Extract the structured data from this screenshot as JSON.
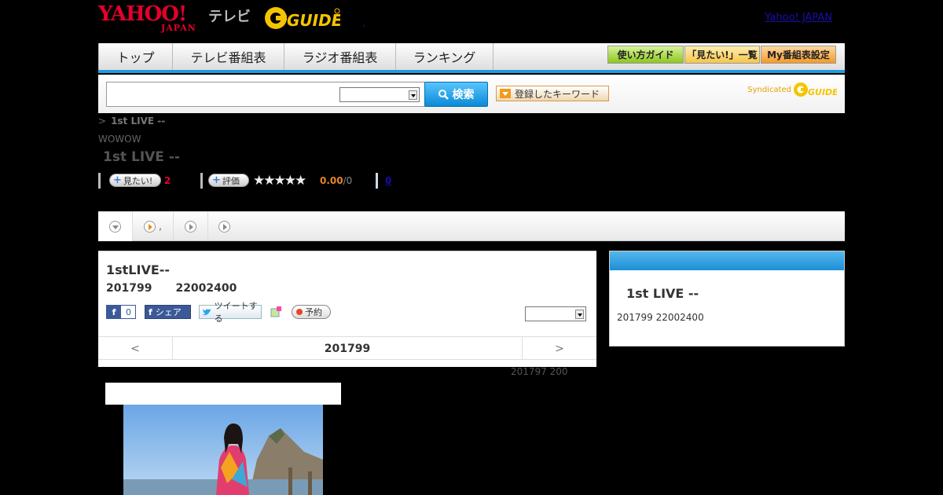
{
  "header": {
    "yahoo_logo": "YAHOO!",
    "yahoo_sub": "JAPAN",
    "tv_label": "テレビ",
    "gguide_logo": "G GUIDE",
    "dot": ",",
    "link": "Yahoo! JAPAN"
  },
  "nav": {
    "tabs": [
      "トップ",
      "テレビ番組表",
      "ラジオ番組表",
      "ランキング"
    ],
    "buttons": [
      "使い方ガイド",
      "「見たい!」一覧",
      "My番組表設定"
    ]
  },
  "search": {
    "button": "検索",
    "keyword_button": "登録したキーワード",
    "syndicated": "Syndicated",
    "brand": "G GUIDE"
  },
  "breadcrumb": {
    "sep": ">",
    "current": "1st LIVE --"
  },
  "program": {
    "channel": "WOWOW",
    "title": "1st LIVE --",
    "want_label": "見たい!",
    "want_count": "2",
    "rate_label": "評価",
    "stars": "★★★★★",
    "score": "0.00",
    "score_total": "/0",
    "comments": "0"
  },
  "tabbar": {
    "second_label": ","
  },
  "main": {
    "title": "1stLIVE--",
    "date": "201799",
    "time": "22002400",
    "fb_count": "0",
    "share": "シェア",
    "tweet": "ツイートする",
    "reserve": "予約",
    "pager_prev": "<",
    "pager_date": "201799",
    "pager_next": ">",
    "foot_note": "201797  200"
  },
  "side": {
    "title": "1st LIVE --",
    "date": "201799  22002400"
  },
  "colors": {
    "accent_blue": "#1e9be0",
    "yahoo_red": "#e4002b",
    "gguide_yellow": "#f5c400"
  }
}
